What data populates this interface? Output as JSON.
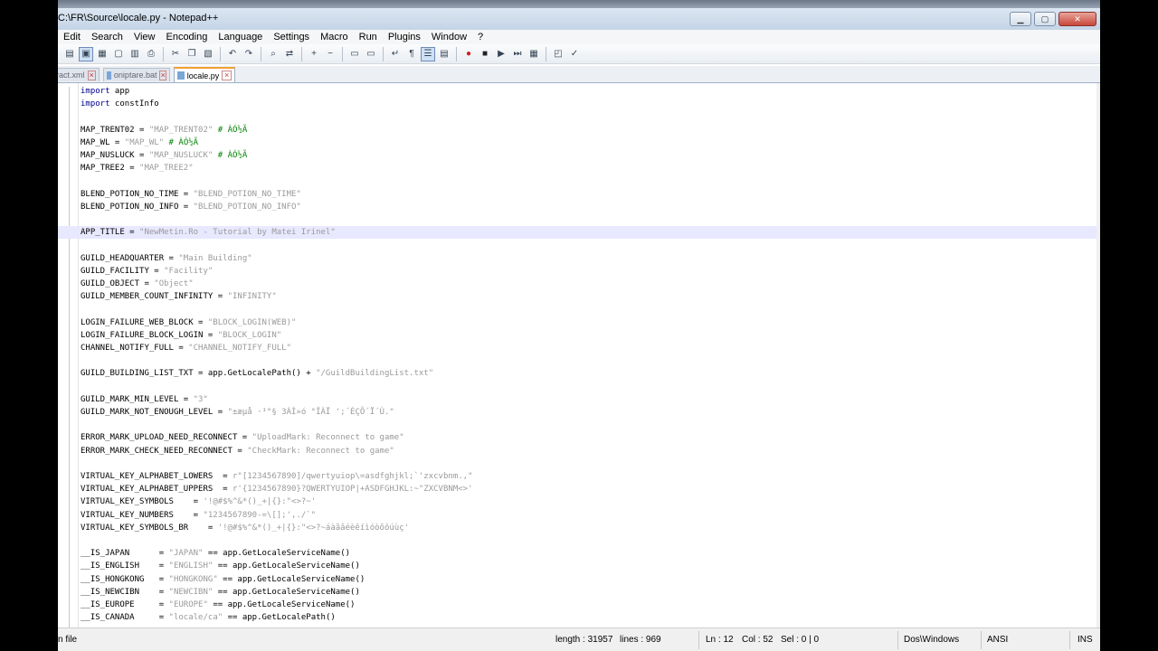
{
  "window": {
    "title": "C:\\FR\\Source\\locale.py - Notepad++"
  },
  "window_buttons": {
    "minimize": "▁",
    "maximize": "▢",
    "close": "✕"
  },
  "menu": [
    "Edit",
    "Search",
    "View",
    "Encoding",
    "Language",
    "Settings",
    "Macro",
    "Run",
    "Plugins",
    "Window",
    "?"
  ],
  "toolbar": {
    "icons": [
      "open-icon",
      "save-icon",
      "save-all-icon",
      "close-icon",
      "close-all-icon",
      "print-icon",
      "cut-icon",
      "copy-icon",
      "paste-icon",
      "undo-icon",
      "redo-icon",
      "find-icon",
      "replace-icon",
      "zoom-in-icon",
      "zoom-out-icon",
      "sync-v-icon",
      "sync-h-icon",
      "wrap-icon",
      "show-all-icon",
      "indent-guide-icon",
      "fold-icon",
      "record-icon",
      "stop-icon",
      "play-icon",
      "play-multi-icon",
      "save-macro-icon",
      "plugin-icon",
      "spellcheck-icon"
    ]
  },
  "tabs": [
    {
      "label": "ract.xml",
      "active": false
    },
    {
      "label": "oniptare.bat",
      "active": false
    },
    {
      "label": "locale.py",
      "active": true
    }
  ],
  "editor": {
    "lines": [
      [
        {
          "t": "import",
          "c": "kw"
        },
        {
          "t": " app",
          "c": ""
        }
      ],
      [
        {
          "t": "import",
          "c": "kw"
        },
        {
          "t": " constInfo",
          "c": ""
        }
      ],
      [],
      [
        {
          "t": "MAP_TRENT02 = ",
          "c": ""
        },
        {
          "t": "\"MAP_TRENT02\"",
          "c": "str"
        },
        {
          "t": " # ÀÓ½Ã",
          "c": "cm"
        }
      ],
      [
        {
          "t": "MAP_WL = ",
          "c": ""
        },
        {
          "t": "\"MAP_WL\"",
          "c": "str"
        },
        {
          "t": " # ÀÓ½Ã",
          "c": "cm"
        }
      ],
      [
        {
          "t": "MAP_NUSLUCK = ",
          "c": ""
        },
        {
          "t": "\"MAP_NUSLUCK\"",
          "c": "str"
        },
        {
          "t": " # ÀÓ½Ã",
          "c": "cm"
        }
      ],
      [
        {
          "t": "MAP_TREE2 = ",
          "c": ""
        },
        {
          "t": "\"MAP_TREE2\"",
          "c": "str"
        }
      ],
      [],
      [
        {
          "t": "BLEND_POTION_NO_TIME = ",
          "c": ""
        },
        {
          "t": "\"BLEND_POTION_NO_TIME\"",
          "c": "str"
        }
      ],
      [
        {
          "t": "BLEND_POTION_NO_INFO = ",
          "c": ""
        },
        {
          "t": "\"BLEND_POTION_NO_INFO\"",
          "c": "str"
        }
      ],
      [],
      [
        {
          "t": "APP_TITLE = ",
          "c": ""
        },
        {
          "t": "\"NewMetin.Ro - Tutorial by Matei Irinel\"",
          "c": "str"
        }
      ],
      [],
      [
        {
          "t": "GUILD_HEADQUARTER = ",
          "c": ""
        },
        {
          "t": "\"Main Building\"",
          "c": "str"
        }
      ],
      [
        {
          "t": "GUILD_FACILITY = ",
          "c": ""
        },
        {
          "t": "\"Facility\"",
          "c": "str"
        }
      ],
      [
        {
          "t": "GUILD_OBJECT = ",
          "c": ""
        },
        {
          "t": "\"Object\"",
          "c": "str"
        }
      ],
      [
        {
          "t": "GUILD_MEMBER_COUNT_INFINITY = ",
          "c": ""
        },
        {
          "t": "\"INFINITY\"",
          "c": "str"
        }
      ],
      [],
      [
        {
          "t": "LOGIN_FAILURE_WEB_BLOCK = ",
          "c": ""
        },
        {
          "t": "\"BLOCK_LOGIN(WEB)\"",
          "c": "str"
        }
      ],
      [
        {
          "t": "LOGIN_FAILURE_BLOCK_LOGIN = ",
          "c": ""
        },
        {
          "t": "\"BLOCK_LOGIN\"",
          "c": "str"
        }
      ],
      [
        {
          "t": "CHANNEL_NOTIFY_FULL = ",
          "c": ""
        },
        {
          "t": "\"CHANNEL_NOTIFY_FULL\"",
          "c": "str"
        }
      ],
      [],
      [
        {
          "t": "GUILD_BUILDING_LIST_TXT = app.GetLocalePath() + ",
          "c": ""
        },
        {
          "t": "\"/GuildBuildingList.txt\"",
          "c": "str"
        }
      ],
      [],
      [
        {
          "t": "GUILD_MARK_MIN_LEVEL = ",
          "c": ""
        },
        {
          "t": "\"3\"",
          "c": "str"
        }
      ],
      [
        {
          "t": "GUILD_MARK_NOT_ENOUGH_LEVEL = ",
          "c": ""
        },
        {
          "t": "\"±æµå ·¹°§ 3ÀÌ»ó °ÎÀÏ ';´ÉÇÕ´Ï´Ù.\"",
          "c": "str"
        }
      ],
      [],
      [
        {
          "t": "ERROR_MARK_UPLOAD_NEED_RECONNECT = ",
          "c": ""
        },
        {
          "t": "\"UploadMark: Reconnect to game\"",
          "c": "str"
        }
      ],
      [
        {
          "t": "ERROR_MARK_CHECK_NEED_RECONNECT = ",
          "c": ""
        },
        {
          "t": "\"CheckMark: Reconnect to game\"",
          "c": "str"
        }
      ],
      [],
      [
        {
          "t": "VIRTUAL_KEY_ALPHABET_LOWERS  = ",
          "c": ""
        },
        {
          "t": "r\"[1234567890]/qwertyuiop\\=asdfghjkl;`'zxcvbnm.,\"",
          "c": "str"
        }
      ],
      [
        {
          "t": "VIRTUAL_KEY_ALPHABET_UPPERS  = ",
          "c": ""
        },
        {
          "t": "r'{1234567890}?QWERTYUIOP|+ASDFGHJKL:~\"ZXCVBNM<>'",
          "c": "str"
        }
      ],
      [
        {
          "t": "VIRTUAL_KEY_SYMBOLS    = ",
          "c": ""
        },
        {
          "t": "'!@#$%^&*()_+|{}:\"<>?~'",
          "c": "str"
        }
      ],
      [
        {
          "t": "VIRTUAL_KEY_NUMBERS    = ",
          "c": ""
        },
        {
          "t": "\"1234567890-=\\[];',./`\"",
          "c": "str"
        }
      ],
      [
        {
          "t": "VIRTUAL_KEY_SYMBOLS_BR    = ",
          "c": ""
        },
        {
          "t": "'!@#$%^&*()_+|{}:\"<>?~áàãâéèêíìóòõôúùç'",
          "c": "str"
        }
      ],
      [],
      [
        {
          "t": "__IS_JAPAN      = ",
          "c": ""
        },
        {
          "t": "\"JAPAN\"",
          "c": "str"
        },
        {
          "t": " == app.GetLocaleServiceName()",
          "c": ""
        }
      ],
      [
        {
          "t": "__IS_ENGLISH    = ",
          "c": ""
        },
        {
          "t": "\"ENGLISH\"",
          "c": "str"
        },
        {
          "t": " == app.GetLocaleServiceName()",
          "c": ""
        }
      ],
      [
        {
          "t": "__IS_HONGKONG   = ",
          "c": ""
        },
        {
          "t": "\"HONGKONG\"",
          "c": "str"
        },
        {
          "t": " == app.GetLocaleServiceName()",
          "c": ""
        }
      ],
      [
        {
          "t": "__IS_NEWCIBN    = ",
          "c": ""
        },
        {
          "t": "\"NEWCIBN\"",
          "c": "str"
        },
        {
          "t": " == app.GetLocaleServiceName()",
          "c": ""
        }
      ],
      [
        {
          "t": "__IS_EUROPE     = ",
          "c": ""
        },
        {
          "t": "\"EUROPE\"",
          "c": "str"
        },
        {
          "t": " == app.GetLocaleServiceName()",
          "c": ""
        }
      ],
      [
        {
          "t": "__IS_CANADA     = ",
          "c": ""
        },
        {
          "t": "\"locale/ca\"",
          "c": "str"
        },
        {
          "t": " == app.GetLocalePath()",
          "c": ""
        }
      ]
    ]
  },
  "status": {
    "filetype": "n file",
    "length": "length : 31957",
    "lines": "lines : 969",
    "ln": "Ln : 12",
    "col": "Col : 52",
    "sel": "Sel : 0 | 0",
    "eol": "Dos\\Windows",
    "encoding": "ANSI",
    "mode": "INS"
  },
  "colors": {
    "keyword": "#00008b",
    "string": "#9a9a9a",
    "comment": "#008000",
    "current_line": "#e8e8ff"
  }
}
